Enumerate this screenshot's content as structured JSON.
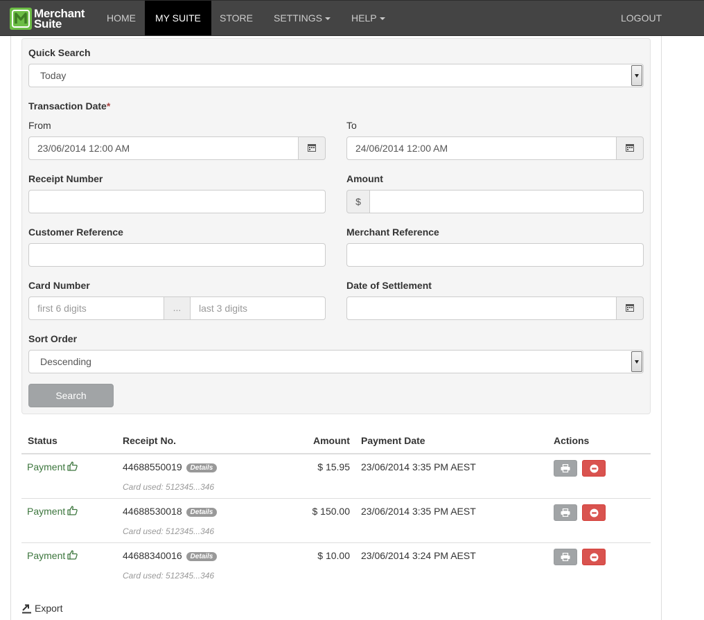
{
  "nav": {
    "brand_line1": "Merchant",
    "brand_line2": "Suite",
    "home": "HOME",
    "my_suite": "MY SUITE",
    "store": "STORE",
    "settings": "SETTINGS",
    "help": "HELP",
    "logout": "LOGOUT"
  },
  "form": {
    "quick_search_label": "Quick Search",
    "quick_search_value": "Today",
    "transaction_date_label": "Transaction Date",
    "required_mark": "*",
    "from_label": "From",
    "from_value": "23/06/2014 12:00 AM",
    "to_label": "To",
    "to_value": "24/06/2014 12:00 AM",
    "receipt_number_label": "Receipt Number",
    "amount_label": "Amount",
    "currency_symbol": "$",
    "customer_reference_label": "Customer Reference",
    "merchant_reference_label": "Merchant Reference",
    "card_number_label": "Card Number",
    "card_first_placeholder": "first 6 digits",
    "card_separator": "...",
    "card_last_placeholder": "last 3 digits",
    "date_of_settlement_label": "Date of Settlement",
    "sort_order_label": "Sort Order",
    "sort_order_value": "Descending",
    "search_button": "Search"
  },
  "table": {
    "headers": {
      "status": "Status",
      "receipt": "Receipt No.",
      "amount": "Amount",
      "payment_date": "Payment Date",
      "actions": "Actions"
    },
    "details_badge": "Details",
    "rows": [
      {
        "status": "Payment",
        "receipt": "44688550019",
        "card_used": "Card used: 512345...346",
        "amount": "$ 15.95",
        "date": "23/06/2014 3:35 PM AEST"
      },
      {
        "status": "Payment",
        "receipt": "44688530018",
        "card_used": "Card used: 512345...346",
        "amount": "$ 150.00",
        "date": "23/06/2014 3:35 PM AEST"
      },
      {
        "status": "Payment",
        "receipt": "44688340016",
        "card_used": "Card used: 512345...346",
        "amount": "$ 10.00",
        "date": "23/06/2014 3:24 PM AEST"
      }
    ]
  },
  "export_label": "Export",
  "colors": {
    "navbar": "#444444",
    "brand_green": "#6cbd45",
    "status_green": "#3c763d",
    "remove_red": "#d9534f"
  }
}
